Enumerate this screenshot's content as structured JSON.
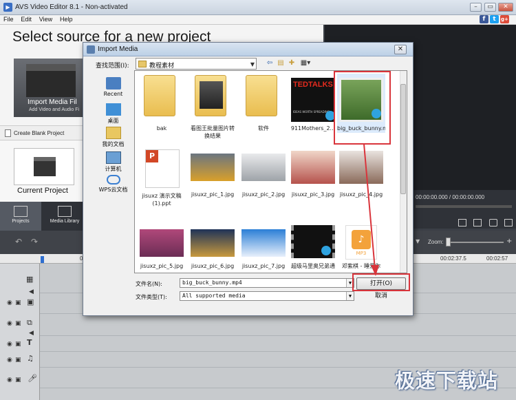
{
  "app": {
    "title": "AVS Video Editor 8.1 - Non-activated",
    "menu": [
      "File",
      "Edit",
      "View",
      "Help"
    ],
    "heading": "Select source for a new project",
    "import_tile": {
      "title": "Import Media Fil",
      "subtitle": "Add Video and Audio Fi"
    },
    "create_blank": "Create Blank Project",
    "current_project": "Current Project",
    "tabs": [
      "Projects",
      "Media Library"
    ],
    "timecode": "00:00:00.000 / 00:00:00.000",
    "zoom_label": "Zoom:",
    "ruler": {
      "left": "0",
      "r1": "00:02:37.5",
      "r2": "00:02:57"
    },
    "social": [
      "f",
      "t",
      "g+"
    ]
  },
  "dialog": {
    "title": "Import Media",
    "lookin_label": "查找范围(I):",
    "lookin_value": "教程素材",
    "places": [
      "Recent",
      "桌面",
      "我的文档",
      "计算机",
      "WPS云文档"
    ],
    "files": [
      {
        "name": "bak",
        "kind": "folder"
      },
      {
        "name": "看图王批量图片转换结果",
        "kind": "folder"
      },
      {
        "name": "软件",
        "kind": "folder"
      },
      {
        "name": "911Mothers_2...",
        "kind": "video"
      },
      {
        "name": "big_buck_bunny.mp4",
        "kind": "video",
        "selected": true
      },
      {
        "name": "jisuxz 演示文稿(1).ppt",
        "kind": "ppt"
      },
      {
        "name": "jisuxz_pic_1.jpg",
        "kind": "image"
      },
      {
        "name": "jisuxz_pic_2.jpg",
        "kind": "image"
      },
      {
        "name": "jisuxz_pic_3.jpg",
        "kind": "image"
      },
      {
        "name": "jisuxz_pic_4.jpg",
        "kind": "image"
      },
      {
        "name": "jisuxz_pic_5.jpg",
        "kind": "image"
      },
      {
        "name": "jisuxz_pic_6.jpg",
        "kind": "image"
      },
      {
        "name": "jisuxz_pic_7.jpg",
        "kind": "image"
      },
      {
        "name": "超级马里奥兄弟通",
        "kind": "video"
      },
      {
        "name": "邓紫棋 - 睡爱你",
        "kind": "audio"
      }
    ],
    "filename_label": "文件名(N):",
    "filename_value": "big_buck_bunny.mp4",
    "filetype_label": "文件类型(T):",
    "filetype_value": "All supported media",
    "open_button": "打开(O)",
    "cancel_button": "取消",
    "ted_text": "TEDTALKS",
    "ted_sub": "IDEAS WORTH SPREADING",
    "mp3_tag": "MP3"
  },
  "colors": {
    "highlight": "#d9343b",
    "folder": "#e9bd4f",
    "dialog_bg": "#f0f0f0"
  },
  "watermark": "极速下载站"
}
